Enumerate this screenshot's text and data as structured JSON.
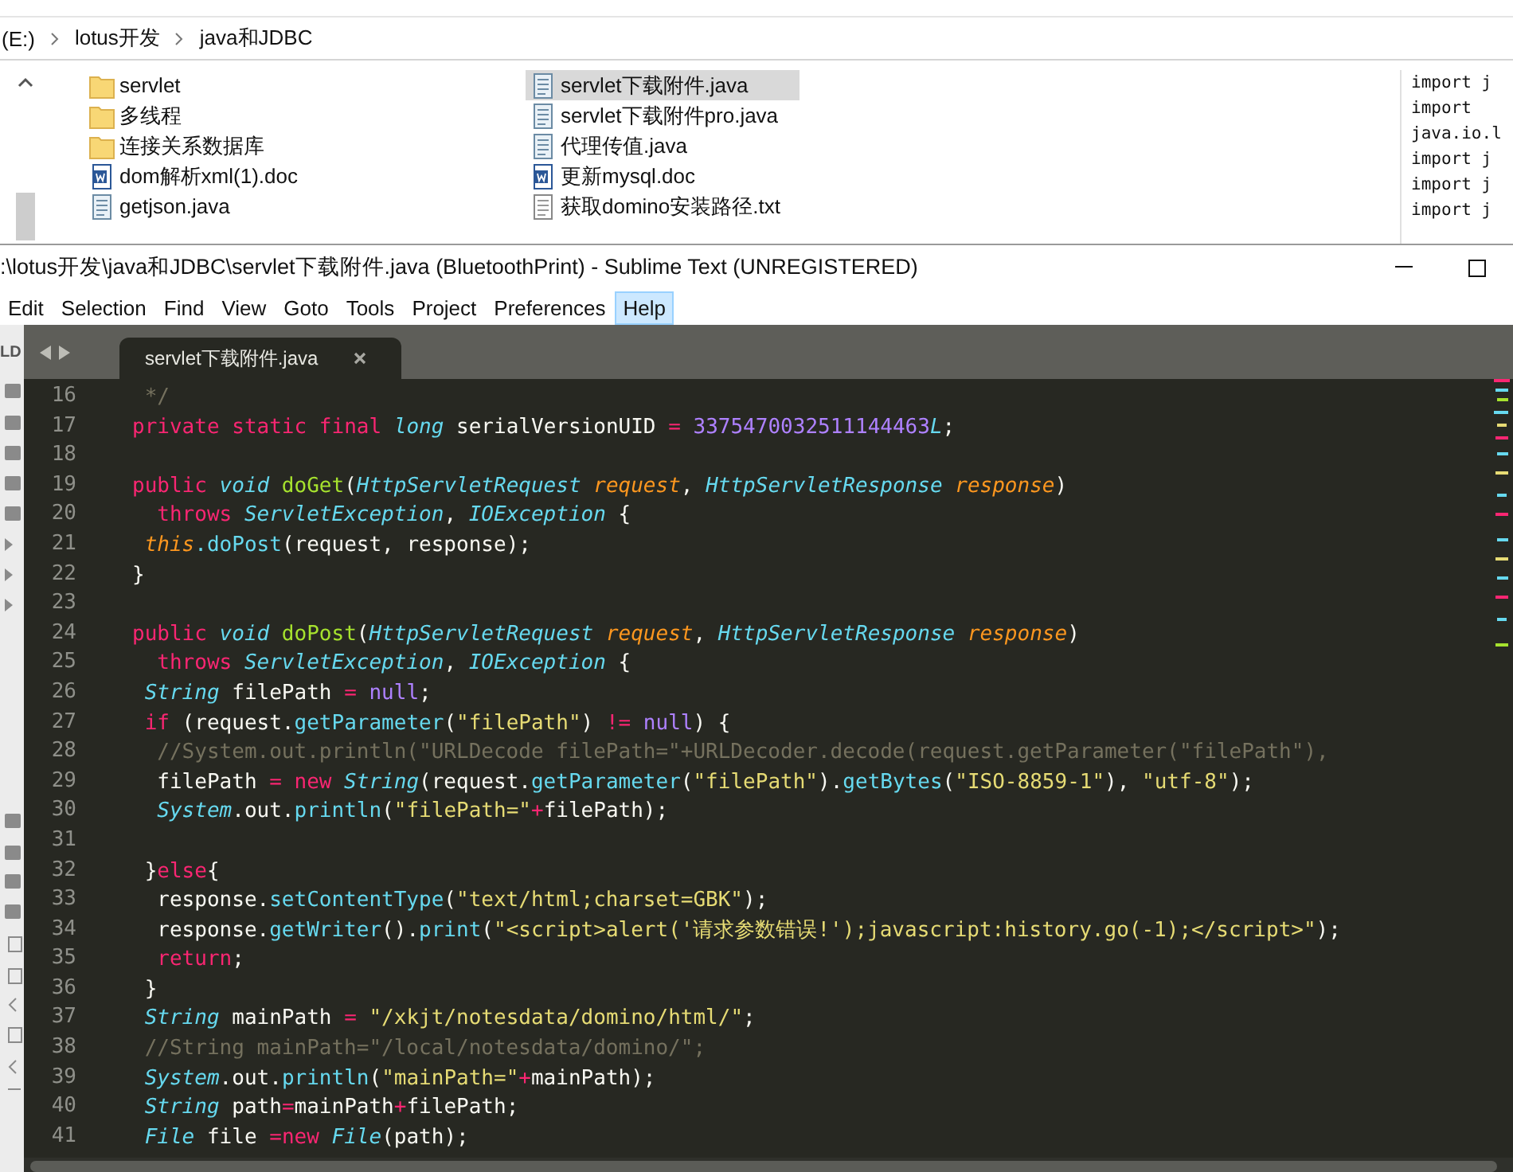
{
  "explorer": {
    "breadcrumb": [
      "(E:)",
      "lotus开发",
      "java和JDBC"
    ],
    "file_columns": [
      {
        "items": [
          {
            "name": "servlet",
            "kind": "folder",
            "selected": false
          },
          {
            "name": "多线程",
            "kind": "folder",
            "selected": false
          },
          {
            "name": "连接关系数据库",
            "kind": "folder",
            "selected": false
          },
          {
            "name": "dom解析xml(1).doc",
            "kind": "doc",
            "selected": false
          },
          {
            "name": "getjson.java",
            "kind": "java",
            "selected": false
          }
        ]
      },
      {
        "items": [
          {
            "name": "servlet下载附件.java",
            "kind": "java",
            "selected": true
          },
          {
            "name": "servlet下载附件pro.java",
            "kind": "java",
            "selected": false
          },
          {
            "name": "代理传值.java",
            "kind": "java",
            "selected": false
          },
          {
            "name": "更新mysql.doc",
            "kind": "doc",
            "selected": false
          },
          {
            "name": "获取domino安装路径.txt",
            "kind": "txt",
            "selected": false
          }
        ]
      }
    ],
    "preview_lines": [
      "import j",
      "import",
      "java.io.l",
      "import j",
      "import j",
      "import j"
    ]
  },
  "editor_window": {
    "title": ":\\lotus开发\\java和JDBC\\servlet下载附件.java (BluetoothPrint) - Sublime Text (UNREGISTERED)",
    "menu": [
      {
        "label": "Edit",
        "selected": false
      },
      {
        "label": "Selection",
        "selected": false
      },
      {
        "label": "Find",
        "selected": false
      },
      {
        "label": "View",
        "selected": false
      },
      {
        "label": "Goto",
        "selected": false
      },
      {
        "label": "Tools",
        "selected": false
      },
      {
        "label": "Project",
        "selected": false
      },
      {
        "label": "Preferences",
        "selected": false
      },
      {
        "label": "Help",
        "selected": true
      }
    ],
    "sidebar_label": "LD",
    "tabs": [
      {
        "label": "servlet下载附件.java",
        "selected": true
      }
    ],
    "code_lines": [
      {
        "number": "16",
        "tokens": [
          {
            "kind": "cmt",
            "text": " */"
          }
        ]
      },
      {
        "number": "17",
        "tokens": [
          {
            "kind": "kw",
            "text": "private"
          },
          {
            "kind": "kw",
            "text": " static"
          },
          {
            "kind": "kw",
            "text": " final"
          },
          {
            "kind": "type",
            "text": " long"
          },
          {
            "kind": "plain",
            "text": " serialVersionUID "
          },
          {
            "kind": "op",
            "text": "="
          },
          {
            "kind": "num",
            "text": " 3375470032511144463"
          },
          {
            "kind": "type",
            "text": "L"
          },
          {
            "kind": "plain",
            "text": ";"
          }
        ]
      },
      {
        "number": "18"
      },
      {
        "number": "19",
        "tokens": [
          {
            "kind": "kw",
            "text": "public"
          },
          {
            "kind": "type",
            "text": " void"
          },
          {
            "kind": "fn",
            "text": " doGet"
          },
          {
            "kind": "plain",
            "text": "("
          },
          {
            "kind": "type",
            "text": "HttpServletRequest"
          },
          {
            "kind": "param",
            "text": " request"
          },
          {
            "kind": "plain",
            "text": ", "
          },
          {
            "kind": "type",
            "text": "HttpServletResponse"
          },
          {
            "kind": "param",
            "text": " response"
          },
          {
            "kind": "plain",
            "text": ")"
          }
        ]
      },
      {
        "number": "20",
        "tokens": [
          {
            "kind": "kw",
            "text": "  throws"
          },
          {
            "kind": "type",
            "text": " ServletException"
          },
          {
            "kind": "plain",
            "text": ", "
          },
          {
            "kind": "type",
            "text": "IOException"
          },
          {
            "kind": "plain",
            "text": " {"
          }
        ]
      },
      {
        "number": "21",
        "tokens": [
          {
            "kind": "param",
            "text": " this"
          },
          {
            "kind": "call",
            "text": ".doPost"
          },
          {
            "kind": "plain",
            "text": "(request, response);"
          }
        ]
      },
      {
        "number": "22",
        "tokens": [
          {
            "kind": "plain",
            "text": "}"
          }
        ]
      },
      {
        "number": "23"
      },
      {
        "number": "24",
        "tokens": [
          {
            "kind": "kw",
            "text": "public"
          },
          {
            "kind": "type",
            "text": " void"
          },
          {
            "kind": "fn",
            "text": " doPost"
          },
          {
            "kind": "plain",
            "text": "("
          },
          {
            "kind": "type",
            "text": "HttpServletRequest"
          },
          {
            "kind": "param",
            "text": " request"
          },
          {
            "kind": "plain",
            "text": ", "
          },
          {
            "kind": "type",
            "text": "HttpServletResponse"
          },
          {
            "kind": "param",
            "text": " response"
          },
          {
            "kind": "plain",
            "text": ")"
          }
        ]
      },
      {
        "number": "25",
        "tokens": [
          {
            "kind": "kw",
            "text": "  throws"
          },
          {
            "kind": "type",
            "text": " ServletException"
          },
          {
            "kind": "plain",
            "text": ", "
          },
          {
            "kind": "type",
            "text": "IOException"
          },
          {
            "kind": "plain",
            "text": " {"
          }
        ]
      },
      {
        "number": "26",
        "tokens": [
          {
            "kind": "type",
            "text": " String"
          },
          {
            "kind": "plain",
            "text": " filePath "
          },
          {
            "kind": "op",
            "text": "="
          },
          {
            "kind": "num",
            "text": " null"
          },
          {
            "kind": "plain",
            "text": ";"
          }
        ]
      },
      {
        "number": "27",
        "tokens": [
          {
            "kind": "kw",
            "text": " if"
          },
          {
            "kind": "plain",
            "text": " (request."
          },
          {
            "kind": "call",
            "text": "getParameter"
          },
          {
            "kind": "plain",
            "text": "("
          },
          {
            "kind": "str",
            "text": "\"filePath\""
          },
          {
            "kind": "plain",
            "text": ") "
          },
          {
            "kind": "op",
            "text": "!="
          },
          {
            "kind": "num",
            "text": " null"
          },
          {
            "kind": "plain",
            "text": ") {"
          }
        ]
      },
      {
        "number": "28",
        "tokens": [
          {
            "kind": "cmt",
            "text": "  //System.out.println(\"URLDecode filePath=\"+URLDecoder.decode(request.getParameter(\"filePath\"),"
          }
        ]
      },
      {
        "number": "29",
        "tokens": [
          {
            "kind": "plain",
            "text": "  filePath "
          },
          {
            "kind": "op",
            "text": "="
          },
          {
            "kind": "kw",
            "text": " new"
          },
          {
            "kind": "type",
            "text": " String"
          },
          {
            "kind": "plain",
            "text": "(request."
          },
          {
            "kind": "call",
            "text": "getParameter"
          },
          {
            "kind": "plain",
            "text": "("
          },
          {
            "kind": "str",
            "text": "\"filePath\""
          },
          {
            "kind": "plain",
            "text": ")."
          },
          {
            "kind": "call",
            "text": "getBytes"
          },
          {
            "kind": "plain",
            "text": "("
          },
          {
            "kind": "str",
            "text": "\"ISO-8859-1\""
          },
          {
            "kind": "plain",
            "text": "), "
          },
          {
            "kind": "str",
            "text": "\"utf-8\""
          },
          {
            "kind": "plain",
            "text": ");"
          }
        ]
      },
      {
        "number": "30",
        "tokens": [
          {
            "kind": "type",
            "text": "  System"
          },
          {
            "kind": "plain",
            "text": ".out."
          },
          {
            "kind": "call",
            "text": "println"
          },
          {
            "kind": "plain",
            "text": "("
          },
          {
            "kind": "str",
            "text": "\"filePath=\""
          },
          {
            "kind": "op",
            "text": "+"
          },
          {
            "kind": "plain",
            "text": "filePath);"
          }
        ]
      },
      {
        "number": "31"
      },
      {
        "number": "32",
        "tokens": [
          {
            "kind": "plain",
            "text": " }"
          },
          {
            "kind": "kw",
            "text": "else"
          },
          {
            "kind": "plain",
            "text": "{"
          }
        ]
      },
      {
        "number": "33",
        "tokens": [
          {
            "kind": "plain",
            "text": "  response."
          },
          {
            "kind": "call",
            "text": "setContentType"
          },
          {
            "kind": "plain",
            "text": "("
          },
          {
            "kind": "str",
            "text": "\"text/html;charset=GBK\""
          },
          {
            "kind": "plain",
            "text": ");"
          }
        ]
      },
      {
        "number": "34",
        "tokens": [
          {
            "kind": "plain",
            "text": "  response."
          },
          {
            "kind": "call",
            "text": "getWriter"
          },
          {
            "kind": "plain",
            "text": "()."
          },
          {
            "kind": "call",
            "text": "print"
          },
          {
            "kind": "plain",
            "text": "("
          },
          {
            "kind": "str",
            "text": "\"<script>alert('请求参数错误!');javascript:history.go(-1);</script>\""
          },
          {
            "kind": "plain",
            "text": ");"
          }
        ]
      },
      {
        "number": "35",
        "tokens": [
          {
            "kind": "kw",
            "text": "  return"
          },
          {
            "kind": "plain",
            "text": ";"
          }
        ]
      },
      {
        "number": "36",
        "tokens": [
          {
            "kind": "plain",
            "text": " }"
          }
        ]
      },
      {
        "number": "37",
        "tokens": [
          {
            "kind": "type",
            "text": " String"
          },
          {
            "kind": "plain",
            "text": " mainPath "
          },
          {
            "kind": "op",
            "text": "="
          },
          {
            "kind": "str",
            "text": " \"/xkjt/notesdata/domino/html/\""
          },
          {
            "kind": "plain",
            "text": ";"
          }
        ]
      },
      {
        "number": "38",
        "tokens": [
          {
            "kind": "cmt",
            "text": " //String mainPath=\"/local/notesdata/domino/\";"
          }
        ]
      },
      {
        "number": "39",
        "tokens": [
          {
            "kind": "type",
            "text": " System"
          },
          {
            "kind": "plain",
            "text": ".out."
          },
          {
            "kind": "call",
            "text": "println"
          },
          {
            "kind": "plain",
            "text": "("
          },
          {
            "kind": "str",
            "text": "\"mainPath=\""
          },
          {
            "kind": "op",
            "text": "+"
          },
          {
            "kind": "plain",
            "text": "mainPath);"
          }
        ]
      },
      {
        "number": "40",
        "tokens": [
          {
            "kind": "type",
            "text": " String"
          },
          {
            "kind": "plain",
            "text": " path"
          },
          {
            "kind": "op",
            "text": "="
          },
          {
            "kind": "plain",
            "text": "mainPath"
          },
          {
            "kind": "op",
            "text": "+"
          },
          {
            "kind": "plain",
            "text": "filePath;"
          }
        ]
      },
      {
        "number": "41",
        "tokens": [
          {
            "kind": "type",
            "text": " File"
          },
          {
            "kind": "plain",
            "text": " file "
          },
          {
            "kind": "op",
            "text": "="
          },
          {
            "kind": "kw",
            "text": "new"
          },
          {
            "kind": "type",
            "text": " File"
          },
          {
            "kind": "plain",
            "text": "(path);"
          }
        ]
      }
    ]
  }
}
